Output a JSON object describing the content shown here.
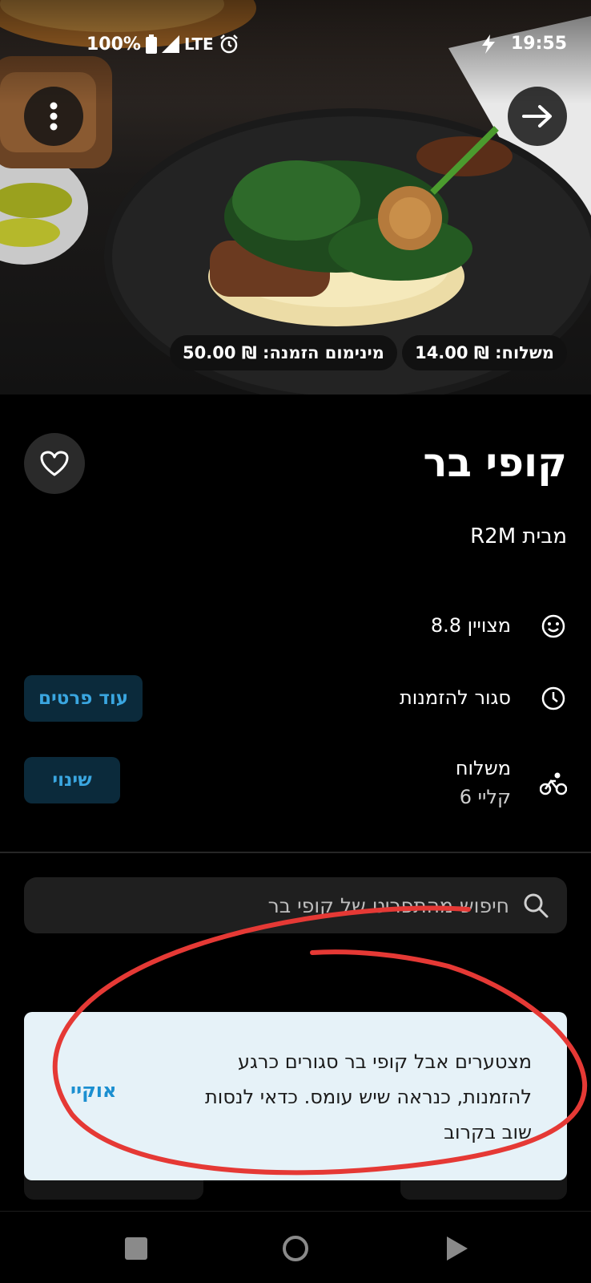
{
  "status_bar": {
    "battery": "100%",
    "network": "LTE",
    "time": "19:55"
  },
  "hero": {
    "delivery_fee": "משלוח: ₪ 14.00",
    "min_order": "מינימום הזמנה: ₪ 50.00"
  },
  "restaurant": {
    "name": "קופי בר",
    "subtitle": "מבית R2M"
  },
  "info": {
    "rating": "מצויין 8.8",
    "status": "סגור להזמנות",
    "more_details_label": "עוד פרטים",
    "delivery_label": "משלוח",
    "delivery_provider": "קליי 6",
    "change_label": "שינוי"
  },
  "search": {
    "placeholder": "חיפוש מהתפריט של קופי בר"
  },
  "toast": {
    "message": "מצטערים אבל קופי בר סגורים כרגע להזמנות, כנראה שיש עומס. כדאי לנסות שוב בקרוב",
    "ok_label": "אוקיי"
  },
  "colors": {
    "accent": "#3aa6e0",
    "toast_bg": "#e6f2f8",
    "annotation": "#e53935"
  }
}
